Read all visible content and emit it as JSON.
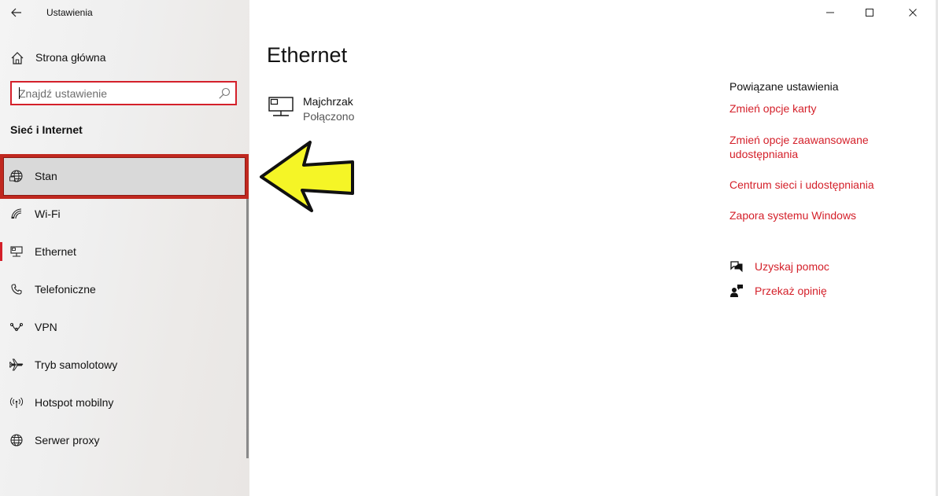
{
  "window": {
    "app_title": "Ustawienia",
    "controls": {
      "minimize": "minimize-icon",
      "maximize": "maximize-icon",
      "close": "close-icon"
    }
  },
  "sidebar": {
    "home_label": "Strona główna",
    "search": {
      "placeholder": "Znajdź ustawienie",
      "value": ""
    },
    "section_title": "Sieć i Internet",
    "items": [
      {
        "label": "Stan",
        "icon": "globe-status-icon",
        "selected": false
      },
      {
        "label": "Wi-Fi",
        "icon": "wifi-icon",
        "selected": false
      },
      {
        "label": "Ethernet",
        "icon": "ethernet-icon",
        "selected": true
      },
      {
        "label": "Telefoniczne",
        "icon": "dialup-icon",
        "selected": false
      },
      {
        "label": "VPN",
        "icon": "vpn-icon",
        "selected": false
      },
      {
        "label": "Tryb samolotowy",
        "icon": "airplane-icon",
        "selected": false
      },
      {
        "label": "Hotspot mobilny",
        "icon": "hotspot-icon",
        "selected": false
      },
      {
        "label": "Serwer proxy",
        "icon": "proxy-globe-icon",
        "selected": false
      }
    ]
  },
  "main": {
    "page_title": "Ethernet",
    "device": {
      "name": "Majchrzak",
      "status": "Połączono"
    },
    "related": {
      "title": "Powiązane ustawienia",
      "links": [
        "Zmień opcje karty",
        "Zmień opcje zaawansowane udostępniania",
        "Centrum sieci i udostępniania",
        "Zapora systemu Windows"
      ]
    },
    "help": [
      {
        "label": "Uzyskaj pomoc",
        "icon": "help-chat-icon"
      },
      {
        "label": "Przekaż opinię",
        "icon": "feedback-icon"
      }
    ]
  },
  "colors": {
    "accent": "#d4202a",
    "highlight_border": "#c0281f",
    "arrow_fill": "#f5f526"
  }
}
